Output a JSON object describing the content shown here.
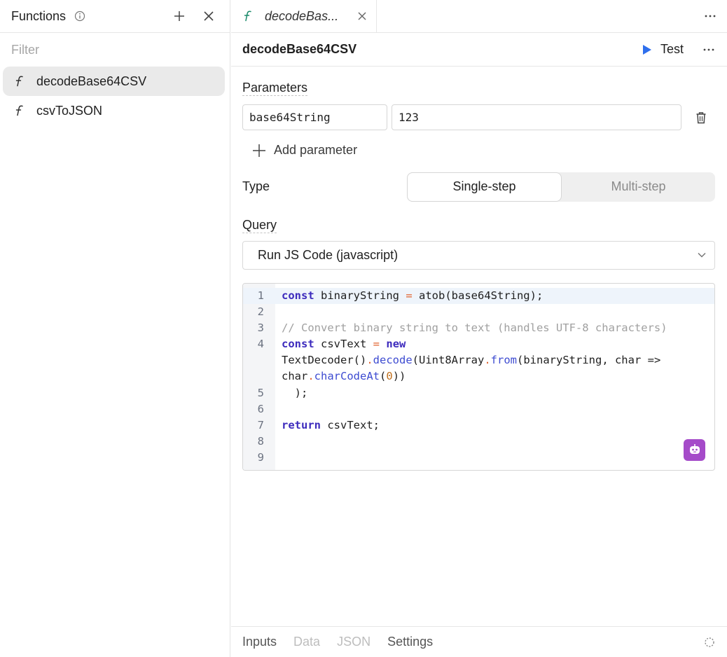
{
  "sidebar": {
    "title": "Functions",
    "filter_placeholder": "Filter",
    "items": [
      {
        "label": "decodeBase64CSV",
        "icon": "function-icon",
        "active": true
      },
      {
        "label": "csvToJSON",
        "icon": "function-icon",
        "active": false
      }
    ]
  },
  "tab": {
    "label": "decodeBas..."
  },
  "function": {
    "name": "decodeBase64CSV",
    "test_label": "Test",
    "parameters_label": "Parameters",
    "param_name": "base64String",
    "param_value": "123",
    "add_parameter_label": "Add parameter",
    "type_label": "Type",
    "type_options": [
      "Single-step",
      "Multi-step"
    ],
    "type_selected": "Single-step",
    "query_label": "Query",
    "query_selected": "Run JS Code (javascript)"
  },
  "editor": {
    "line_numbers": [
      "1",
      "2",
      "3",
      "4",
      "5",
      "6",
      "7",
      "8",
      "9"
    ],
    "lines": [
      "const binaryString = atob(base64String);",
      "",
      "// Convert binary string to text (handles UTF-8 characters)",
      "const csvText = new",
      "TextDecoder().decode(Uint8Array.from(binaryString, char =>",
      "char.charCodeAt(0))",
      "  );",
      "",
      "return csvText;",
      ""
    ]
  },
  "bottom_tabs": [
    "Inputs",
    "Data",
    "JSON",
    "Settings"
  ],
  "colors": {
    "accent_blue": "#2f6fed",
    "ai_purple": "#a54bc9",
    "keyword": "#3d2bbd"
  }
}
